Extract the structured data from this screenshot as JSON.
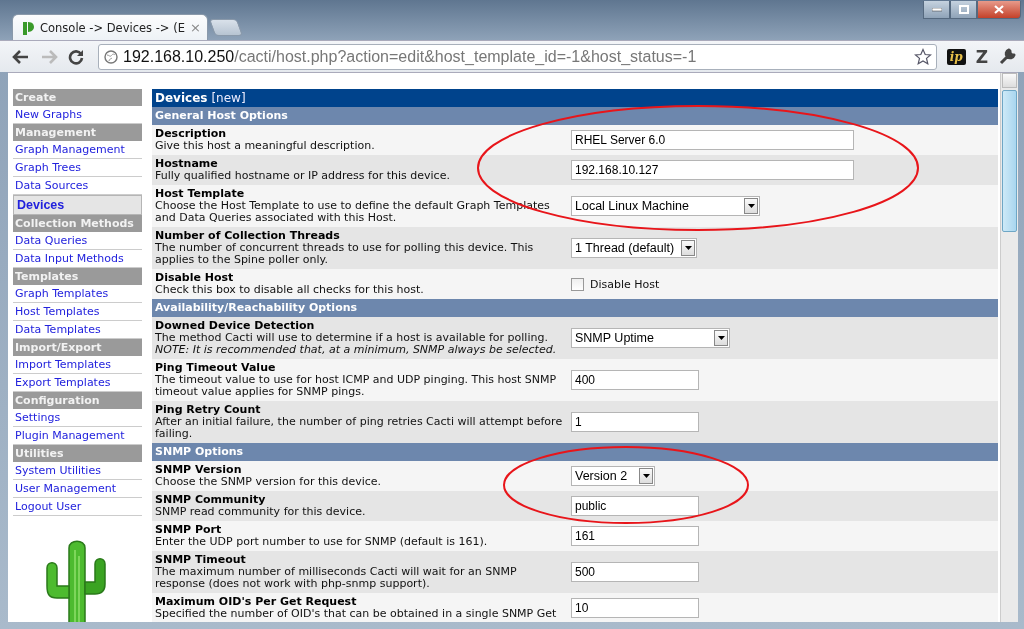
{
  "browser": {
    "tab_title": "Console -> Devices -> (E",
    "tab_close": "×",
    "url_host": "192.168.10.250",
    "url_path": "/cacti/host.php?action=edit&host_template_id=-1&host_status=-1",
    "extensions": [
      {
        "kind": "ip",
        "label": "ip"
      },
      {
        "kind": "letter",
        "label": "Z"
      }
    ]
  },
  "sidebar": {
    "items": [
      {
        "kind": "header",
        "label": "Create"
      },
      {
        "kind": "link",
        "label": "New Graphs",
        "selected": false
      },
      {
        "kind": "header",
        "label": "Management"
      },
      {
        "kind": "link",
        "label": "Graph Management",
        "selected": false
      },
      {
        "kind": "link",
        "label": "Graph Trees",
        "selected": false
      },
      {
        "kind": "link",
        "label": "Data Sources",
        "selected": false
      },
      {
        "kind": "link",
        "label": "Devices",
        "selected": true
      },
      {
        "kind": "header",
        "label": "Collection Methods"
      },
      {
        "kind": "link",
        "label": "Data Queries",
        "selected": false
      },
      {
        "kind": "link",
        "label": "Data Input Methods",
        "selected": false
      },
      {
        "kind": "header",
        "label": "Templates"
      },
      {
        "kind": "link",
        "label": "Graph Templates",
        "selected": false
      },
      {
        "kind": "link",
        "label": "Host Templates",
        "selected": false
      },
      {
        "kind": "link",
        "label": "Data Templates",
        "selected": false
      },
      {
        "kind": "header",
        "label": "Import/Export"
      },
      {
        "kind": "link",
        "label": "Import Templates",
        "selected": false
      },
      {
        "kind": "link",
        "label": "Export Templates",
        "selected": false
      },
      {
        "kind": "header",
        "label": "Configuration"
      },
      {
        "kind": "link",
        "label": "Settings",
        "selected": false
      },
      {
        "kind": "link",
        "label": "Plugin Management",
        "selected": false
      },
      {
        "kind": "header",
        "label": "Utilities"
      },
      {
        "kind": "link",
        "label": "System Utilities",
        "selected": false
      },
      {
        "kind": "link",
        "label": "User Management",
        "selected": false
      },
      {
        "kind": "link",
        "label": "Logout User",
        "selected": false
      }
    ]
  },
  "form": {
    "title": "Devices",
    "title_suffix": "[new]",
    "sections": [
      {
        "title": "General Host Options",
        "rows": [
          {
            "label": "Description",
            "description": "Give this host a meaningful description.",
            "control": {
              "kind": "text",
              "value": "RHEL Server 6.0"
            }
          },
          {
            "label": "Hostname",
            "description": "Fully qualified hostname or IP address for this device.",
            "control": {
              "kind": "text",
              "value": "192.168.10.127"
            }
          },
          {
            "label": "Host Template",
            "description": "Choose the Host Template to use to define the default Graph Templates and Data Queries associated with this Host.",
            "control": {
              "kind": "select",
              "value": "Local Linux Machine"
            }
          },
          {
            "label": "Number of Collection Threads",
            "description": "The number of concurrent threads to use for polling this device. This applies to the Spine poller only.",
            "control": {
              "kind": "select",
              "value": "1 Thread (default)"
            }
          },
          {
            "label": "Disable Host",
            "description": "Check this box to disable all checks for this host.",
            "control": {
              "kind": "checkbox",
              "label": "Disable Host",
              "checked": false
            }
          }
        ]
      },
      {
        "title": "Availability/Reachability Options",
        "rows": [
          {
            "label": "Downed Device Detection",
            "description": "The method Cacti will use to determine if a host is available for polling.",
            "note": "NOTE: It is recommended that, at a minimum, SNMP always be selected.",
            "control": {
              "kind": "select",
              "value": "SNMP Uptime"
            }
          },
          {
            "label": "Ping Timeout Value",
            "description": "The timeout value to use for host ICMP and UDP pinging. This host SNMP timeout value applies for SNMP pings.",
            "control": {
              "kind": "text",
              "value": "400"
            }
          },
          {
            "label": "Ping Retry Count",
            "description": "After an initial failure, the number of ping retries Cacti will attempt before failing.",
            "control": {
              "kind": "text",
              "value": "1"
            }
          }
        ]
      },
      {
        "title": "SNMP Options",
        "rows": [
          {
            "label": "SNMP Version",
            "description": "Choose the SNMP version for this device.",
            "control": {
              "kind": "select",
              "value": "Version 2"
            }
          },
          {
            "label": "SNMP Community",
            "description": "SNMP read community for this device.",
            "control": {
              "kind": "text",
              "value": "public"
            }
          },
          {
            "label": "SNMP Port",
            "description": "Enter the UDP port number to use for SNMP (default is 161).",
            "control": {
              "kind": "text",
              "value": "161"
            }
          },
          {
            "label": "SNMP Timeout",
            "description": "The maximum number of milliseconds Cacti will wait for an SNMP response (does not work with php-snmp support).",
            "control": {
              "kind": "text",
              "value": "500"
            }
          },
          {
            "label": "Maximum OID's Per Get Request",
            "description": "Specified the number of OID's that can be obtained in a single SNMP Get",
            "control": {
              "kind": "text",
              "value": "10"
            }
          }
        ]
      }
    ]
  },
  "annotations": [
    {
      "kind": "ellipse"
    },
    {
      "kind": "ellipse"
    }
  ]
}
